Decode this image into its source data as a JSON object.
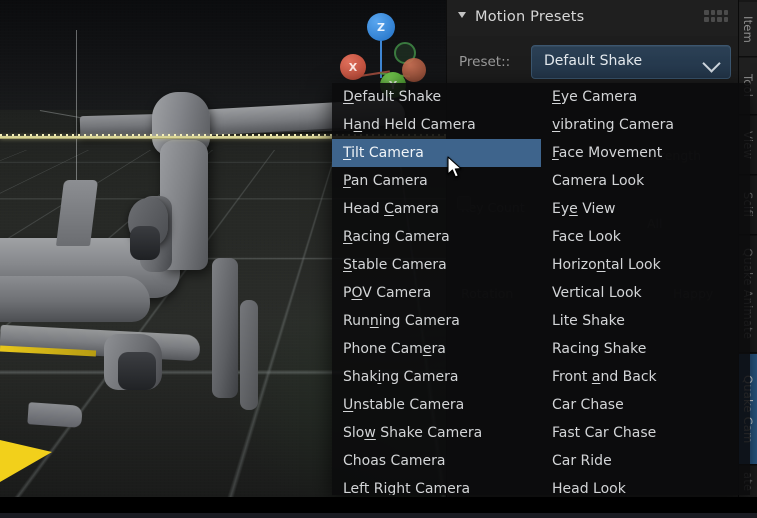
{
  "panel": {
    "title": "Motion Presets",
    "disclosure_icon": "triangle-down-icon",
    "grip_icon": "grip-dots-icon",
    "preset_label": "Preset::",
    "preset_value": "Default Shake",
    "chevron_icon": "chevron-down-icon"
  },
  "menu": {
    "selected": "Tilt Camera",
    "left_column": [
      "Default Shake",
      "Hand Held Camera",
      "Tilt Camera",
      "Pan Camera",
      "Head Camera",
      "Racing Camera",
      "Stable Camera",
      "POV Camera",
      "Running Camera",
      "Phone Camera",
      "Shaking Camera",
      "Unstable Camera",
      "Slow Shake Camera",
      "Choas Camera",
      "Left Right Camera"
    ],
    "right_column": [
      "Eye Camera",
      "vibrating Camera",
      "Face Movement",
      "Camera Look",
      "Eye View",
      "Face Look",
      "Horizontal Look",
      "Vertical Look",
      "Lite Shake",
      "Racing Shake",
      "Front and Back",
      "Car Chase",
      "Fast Car Chase",
      "Car Ride",
      "Head Look"
    ]
  },
  "tabs": [
    {
      "label": "Item",
      "active": false
    },
    {
      "label": "Tool",
      "active": false
    },
    {
      "label": "View",
      "active": false
    },
    {
      "label": "Scifi",
      "active": false
    },
    {
      "label": "Quake Animate",
      "active": false
    },
    {
      "label": "Quake Cam",
      "active": true
    },
    {
      "label": "ate",
      "active": false
    }
  ],
  "viewport": {
    "gizmo": {
      "z": "Z",
      "x": "X",
      "y": "Y"
    },
    "cursor_icon": "arrow-cursor-icon"
  },
  "colors": {
    "accent_select": "#3e648c",
    "tab_active": "#2f6294",
    "preset_field": "#2b4055",
    "axis_x": "#b2412f",
    "axis_y": "#3f9426",
    "axis_z": "#1f6fc4",
    "path_yellow": "#e8e2a0",
    "marker_yellow": "#f2d01b",
    "menu_bg": "#0b0b0c",
    "panel_bg": "#1d1d1d"
  }
}
